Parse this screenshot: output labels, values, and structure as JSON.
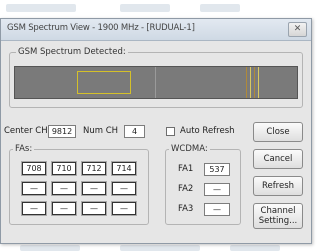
{
  "window": {
    "title": "GSM Spectrum View - 1900 MHz - [RUDUAL-1]",
    "close_glyph": "✕"
  },
  "spectrum": {
    "label": "GSM Spectrum Detected:"
  },
  "controls": {
    "center_ch_label": "Center CH",
    "center_ch_value": "9812",
    "num_ch_label": "Num CH",
    "num_ch_value": "4",
    "auto_refresh_label": "Auto Refresh",
    "auto_refresh_checked": false
  },
  "fas": {
    "label": "FAs:",
    "rows": [
      [
        "708",
        "710",
        "712",
        "714"
      ],
      [
        "—",
        "—",
        "—",
        "—"
      ],
      [
        "—",
        "—",
        "—",
        "—"
      ]
    ]
  },
  "wcdma": {
    "label": "WCDMA:",
    "items": [
      {
        "label": "FA1",
        "value": "537"
      },
      {
        "label": "FA2",
        "value": "—"
      },
      {
        "label": "FA3",
        "value": "—"
      }
    ]
  },
  "buttons": {
    "close": "Close",
    "cancel": "Cancel",
    "refresh": "Refresh",
    "channel_setting": "Channel\nSetting..."
  },
  "colors": {
    "spectrum_bg": "#7a7a7a",
    "highlight_box": "#d4c02a",
    "channel_lines": "#d8c860"
  }
}
